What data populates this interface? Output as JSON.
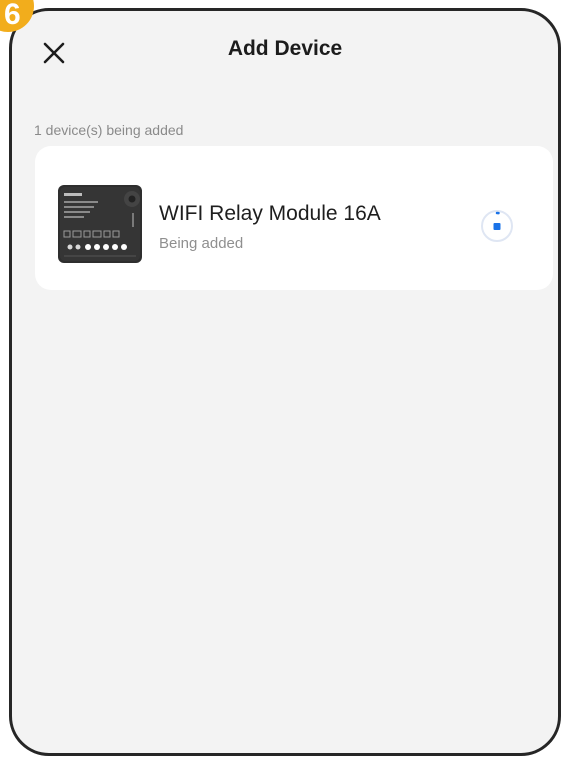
{
  "step": {
    "number": "6"
  },
  "header": {
    "close_icon": "close-icon",
    "title": "Add Device"
  },
  "status": {
    "text": "1 device(s) being added"
  },
  "device": {
    "image_icon": "relay-module-image",
    "name": "WIFI Relay Module 16A",
    "status": "Being added",
    "progress_icon": "loading-spinner-icon"
  },
  "colors": {
    "badge": "#f2ad1c",
    "background": "#f3f3f3",
    "card": "#ffffff",
    "accent": "#1a73e8",
    "frame": "#262626"
  }
}
